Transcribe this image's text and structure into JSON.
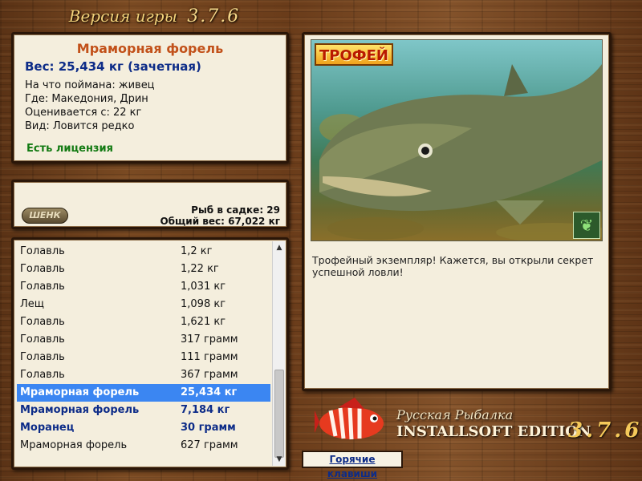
{
  "header": {
    "title": "Версия игры",
    "version": "3.7.6"
  },
  "fish_info": {
    "name": "Мраморная форель",
    "weight": "Вес: 25,434 кг (зачетная)",
    "bait": "На что поймана: живец",
    "location": "Где: Македония, Дрин",
    "rated_from": "Оценивается с: 22 кг",
    "species_note": "Вид: Ловится редко",
    "license": "Есть лицензия"
  },
  "keepnet": {
    "logo": "ШЕНК",
    "count": "Рыб в садке: 29",
    "total_weight": "Общий вес: 67,022 кг"
  },
  "catch_list": [
    {
      "name": "Голавль",
      "weight": "1,2 кг"
    },
    {
      "name": "Голавль",
      "weight": "1,22 кг"
    },
    {
      "name": "Голавль",
      "weight": "1,031 кг"
    },
    {
      "name": "Лещ",
      "weight": "1,098 кг"
    },
    {
      "name": "Голавль",
      "weight": "1,621 кг"
    },
    {
      "name": "Голавль",
      "weight": "317 грамм"
    },
    {
      "name": "Голавль",
      "weight": "111 грамм"
    },
    {
      "name": "Голавль",
      "weight": "367 грамм"
    },
    {
      "name": "Мраморная форель",
      "weight": "25,434 кг"
    },
    {
      "name": "Мраморная форель",
      "weight": "7,184 кг"
    },
    {
      "name": "Моранец",
      "weight": "30 грамм"
    },
    {
      "name": "Мраморная форель",
      "weight": "627 грамм"
    }
  ],
  "photo": {
    "badge": "ТРОФЕЙ",
    "description": "Трофейный экземпляр! Кажется, вы открыли секрет успешной ловли!"
  },
  "brand": {
    "line1": "Русская Рыбалка",
    "line2": "INSTALLSOFT EDITION",
    "version": "3.7.6"
  },
  "hotkeys_label": "Горячие клавиши"
}
